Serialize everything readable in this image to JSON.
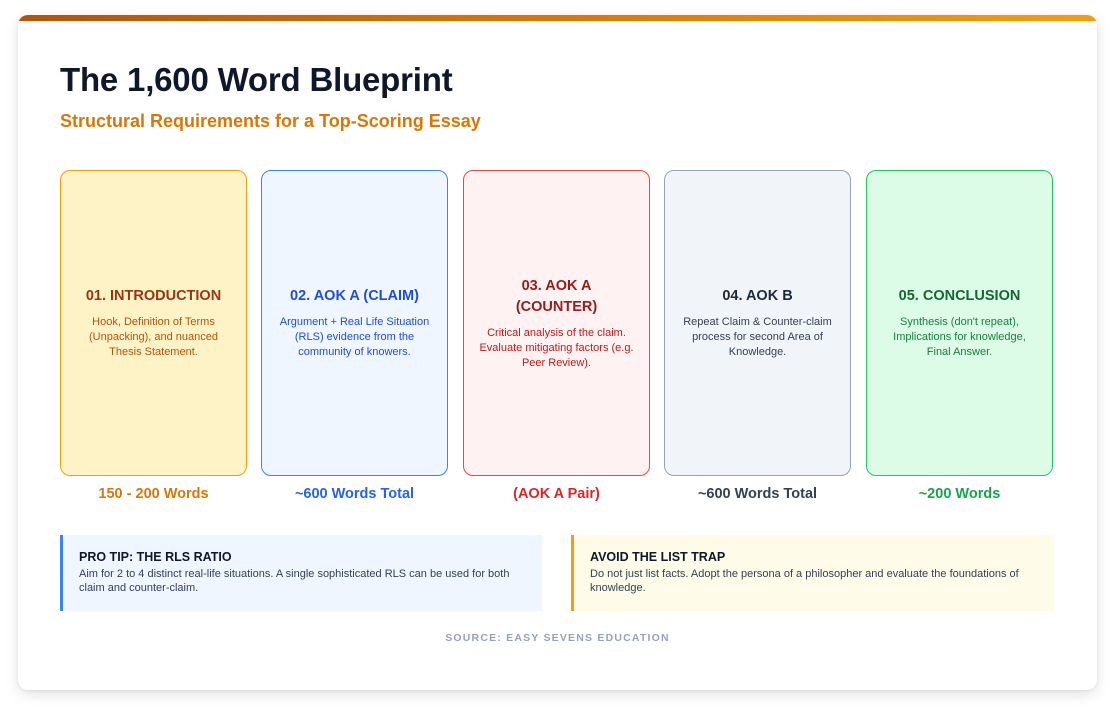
{
  "header": {
    "title": "The 1,600 Word Blueprint",
    "subtitle": "Structural Requirements for a Top-Scoring Essay"
  },
  "sections": [
    {
      "title": "01. INTRODUCTION",
      "description": "Hook, Definition of Terms (Unpacking), and nuanced Thesis Statement.",
      "word_count": "150 - 200 Words",
      "colors": {
        "bg": "#fef3c7",
        "border": "#f59e0b",
        "title": "#9a3412",
        "desc": "#b45309",
        "count": "#d97706"
      }
    },
    {
      "title": "02. AOK A (CLAIM)",
      "description": "Argument + Real Life Situation (RLS) evidence from the community of knowers.",
      "word_count": "~600 Words Total",
      "colors": {
        "bg": "#eff6ff",
        "border": "#3b82f6",
        "title": "#1d4ed8",
        "desc": "#1d4ed8",
        "count": "#2563eb"
      }
    },
    {
      "title": "03. AOK A (COUNTER)",
      "description": "Critical analysis of the claim. Evaluate mitigating factors (e.g. Peer Review).",
      "word_count": "(AOK A Pair)",
      "colors": {
        "bg": "#fef2f2",
        "border": "#ef4444",
        "title": "#991b1b",
        "desc": "#b91c1c",
        "count": "#dc2626"
      }
    },
    {
      "title": "04. AOK B",
      "description": "Repeat Claim & Counter-claim process for second Area of Knowledge.",
      "word_count": "~600 Words Total",
      "colors": {
        "bg": "#f1f5f9",
        "border": "#94a3b8",
        "title": "#1e293b",
        "desc": "#334155",
        "count": "#334155"
      }
    },
    {
      "title": "05. CONCLUSION",
      "description": "Synthesis (don't repeat), Implications for knowledge, Final Answer.",
      "word_count": "~200 Words",
      "colors": {
        "bg": "#dcfce7",
        "border": "#22c55e",
        "title": "#166534",
        "desc": "#15803d",
        "count": "#16a34a"
      }
    }
  ],
  "tips": [
    {
      "title": "PRO TIP: THE RLS RATIO",
      "body": "Aim for 2 to 4 distinct real-life situations. A single sophisticated RLS can be used for both claim and counter-claim.",
      "colors": {
        "bg": "#eff6ff",
        "accent": "#3b82f6"
      }
    },
    {
      "title": "AVOID THE LIST TRAP",
      "body": "Do not just list facts. Adopt the persona of a philosopher and evaluate the foundations of knowledge.",
      "colors": {
        "bg": "#fefce8",
        "accent": "#f59e0b"
      }
    }
  ],
  "footer": {
    "source": "SOURCE: EASY SEVENS EDUCATION"
  }
}
